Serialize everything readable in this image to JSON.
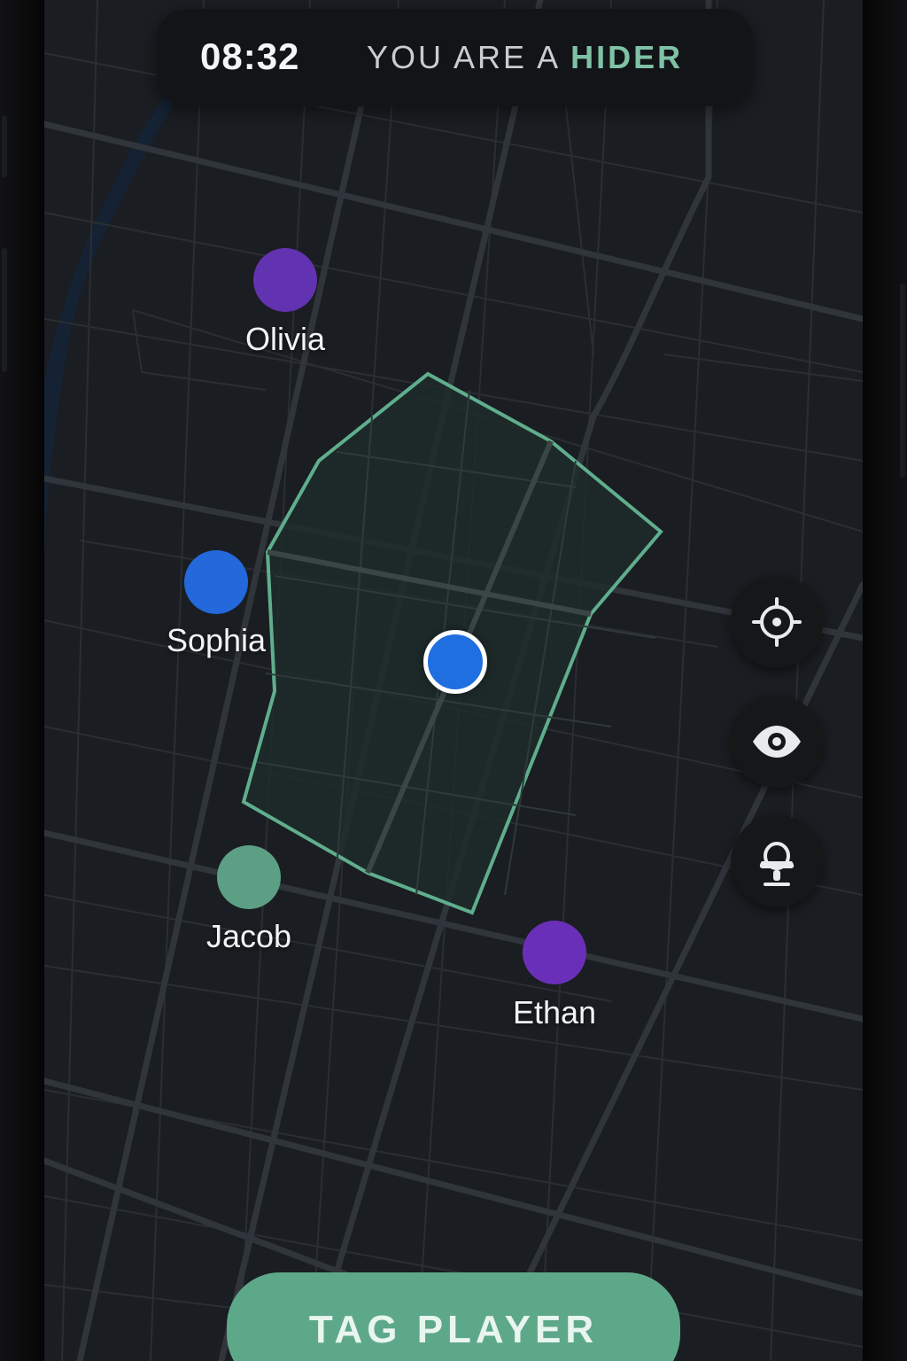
{
  "status": {
    "timer": "08:32",
    "role_prefix": "YOU ARE A ",
    "role_value": "HIDER"
  },
  "players": [
    {
      "name": "Olivia",
      "color": "#6233b0"
    },
    {
      "name": "Sophia",
      "color": "#2369dc"
    },
    {
      "name": "Jacob",
      "color": "#5d9f84"
    },
    {
      "name": "Ethan",
      "color": "#6a2fb8"
    }
  ],
  "self_marker": {
    "color": "#1f6fe0"
  },
  "zone": {
    "stroke": "#5fae8e"
  },
  "controls": [
    {
      "icon": "crosshair-icon"
    },
    {
      "icon": "eye-icon"
    },
    {
      "icon": "hider-avatar-icon"
    }
  ],
  "actions": {
    "tag_label": "TAG PLAYER"
  },
  "colors": {
    "accent": "#7fc1a5",
    "button": "#5ea88a",
    "map_bg": "#1a1d21"
  }
}
